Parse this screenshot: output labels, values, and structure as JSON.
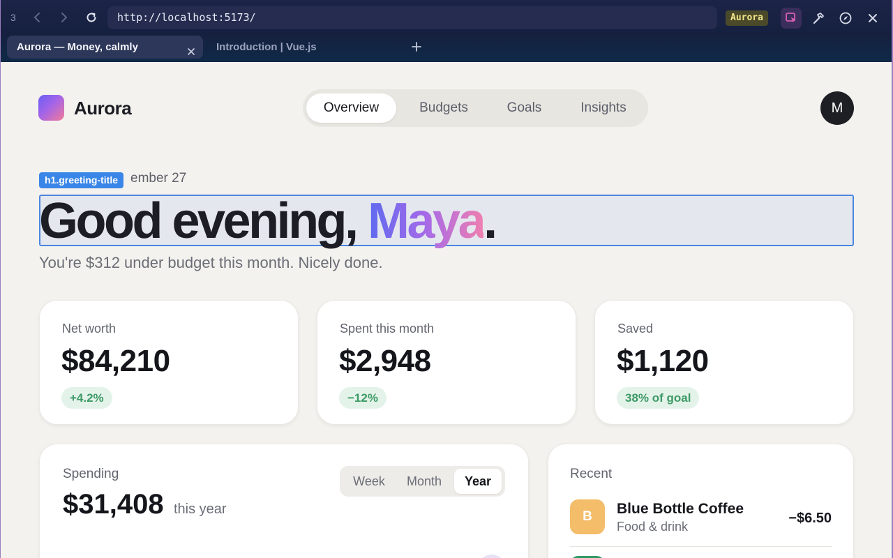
{
  "browser": {
    "tab_count": "3",
    "url": "http://localhost:5173/",
    "dev_badge": "Aurora",
    "tabs": [
      {
        "label": "Aurora — Money, calmly",
        "active": true
      },
      {
        "label": "Introduction | Vue.js",
        "active": false
      }
    ],
    "icons": [
      "back-icon",
      "forward-icon",
      "reload-icon",
      "inspect-element-icon",
      "hammer-icon",
      "compass-icon",
      "close-icon",
      "plus-icon"
    ]
  },
  "app": {
    "brand": "Aurora",
    "nav": [
      "Overview",
      "Budgets",
      "Goals",
      "Insights"
    ],
    "nav_active": "Overview",
    "avatar_initial": "M"
  },
  "header": {
    "date_visible": "ember 27",
    "inspector_tag": "h1.greeting-title",
    "greeting_prefix": "Good evening, ",
    "greeting_name": "Maya",
    "greeting_suffix": ".",
    "subtitle": "You're $312 under budget this month. Nicely done."
  },
  "stats": [
    {
      "label": "Net worth",
      "value": "$84,210",
      "badge": "+4.2%"
    },
    {
      "label": "Spent this month",
      "value": "$2,948",
      "badge": "−12%"
    },
    {
      "label": "Saved",
      "value": "$1,120",
      "badge": "38% of goal"
    }
  ],
  "spending": {
    "label": "Spending",
    "value": "$31,408",
    "unit": "this year",
    "ranges": [
      "Week",
      "Month",
      "Year"
    ],
    "range_active": "Year"
  },
  "recent": {
    "label": "Recent",
    "items": [
      {
        "initial": "B",
        "name": "Blue Bottle Coffee",
        "category": "Food & drink",
        "amount": "−$6.50",
        "color": "#f3bd6a"
      }
    ]
  },
  "colors": {
    "accent": "#6a5cf5",
    "positive": "#3d9a66",
    "inspector": "#3a86e8"
  }
}
